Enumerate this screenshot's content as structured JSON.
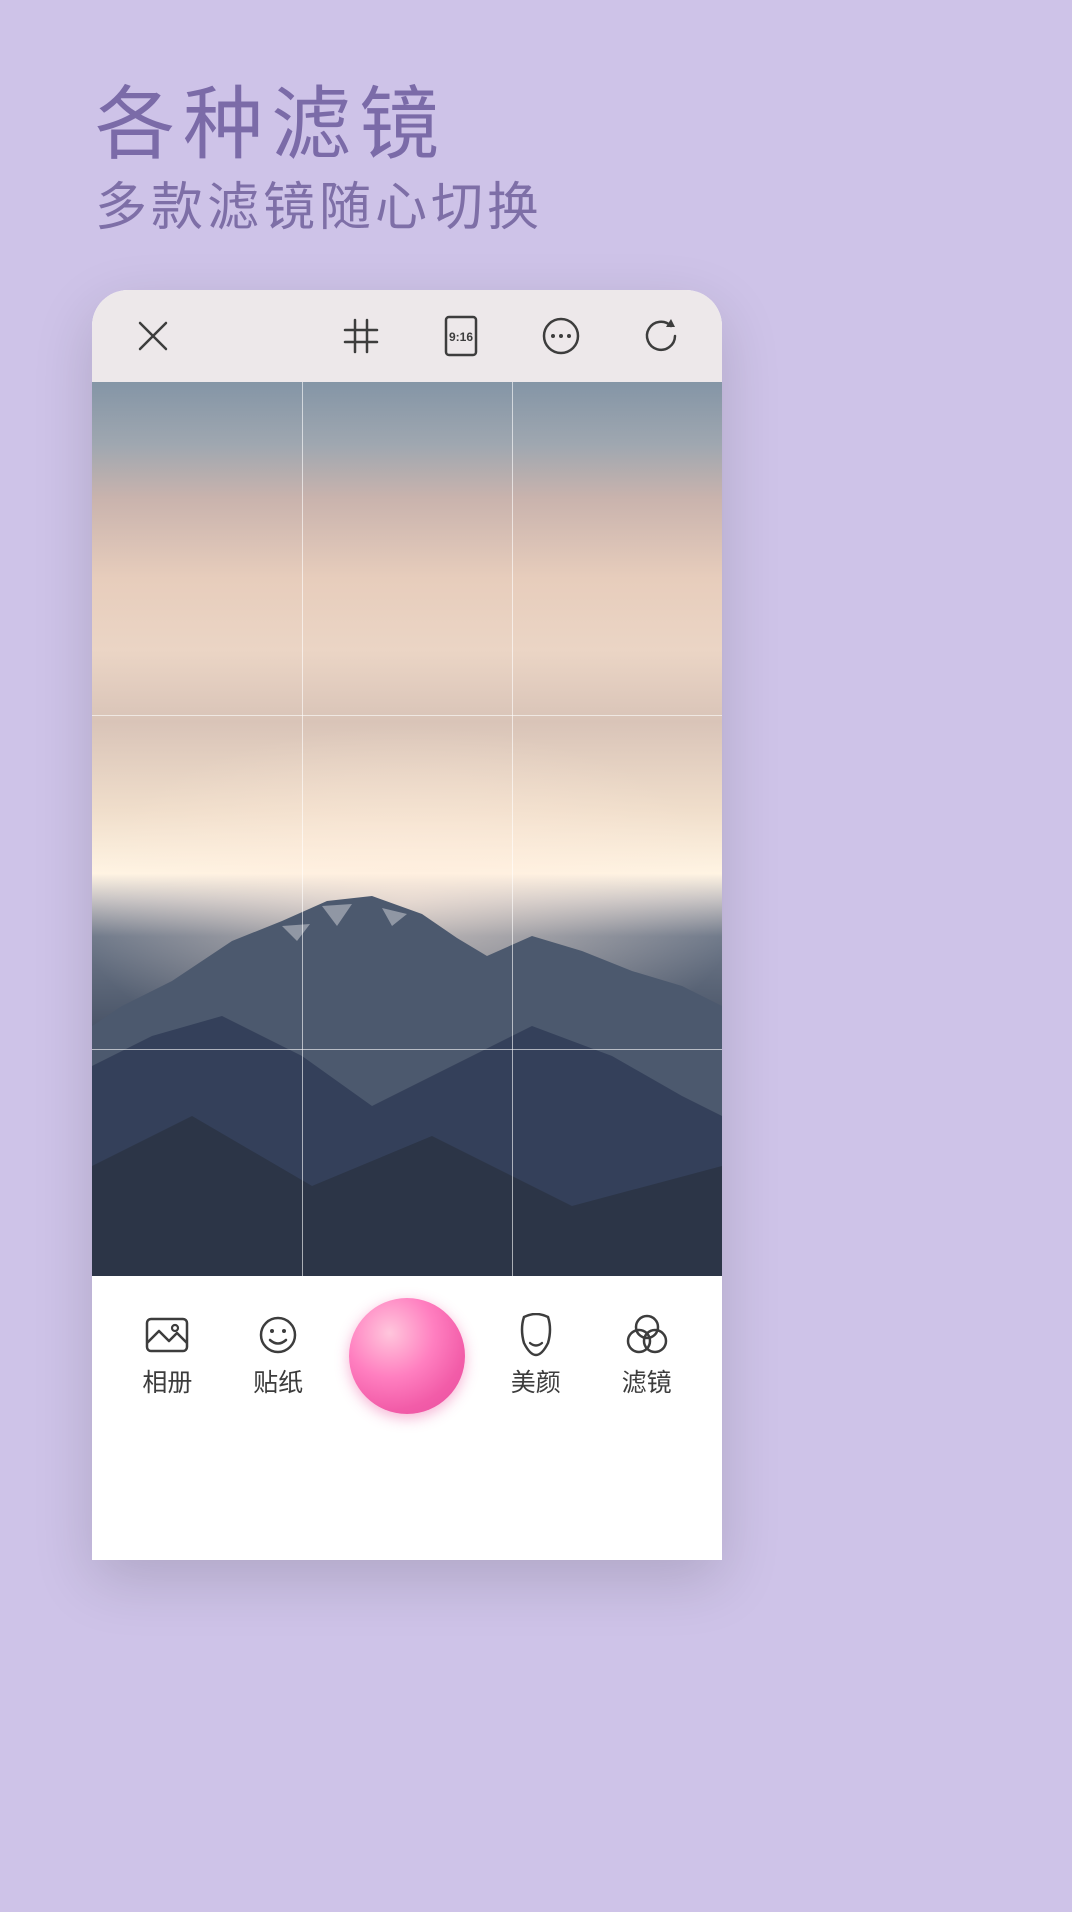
{
  "promo": {
    "title": "各种滤镜",
    "subtitle": "多款滤镜随心切换"
  },
  "topbar": {
    "close_icon": "close",
    "grid_icon": "grid",
    "aspect_icon": "aspect-ratio",
    "aspect_label": "9:16",
    "more_icon": "more",
    "flip_icon": "camera-flip"
  },
  "viewfinder": {
    "subject": "mountain-sunset-clouds",
    "grid_columns": 3,
    "grid_rows": 3
  },
  "bottom": {
    "gallery": {
      "label": "相册",
      "icon": "gallery"
    },
    "sticker": {
      "label": "贴纸",
      "icon": "smile"
    },
    "beauty": {
      "label": "美颜",
      "icon": "face"
    },
    "filter": {
      "label": "滤镜",
      "icon": "overlap-circles"
    }
  },
  "colors": {
    "bg": "#CEC3E8",
    "text_purple": "#7B6BA8",
    "topbar_bg": "#EDE8EA",
    "icon_stroke": "#3D3D3D",
    "shutter_pink_1": "#FFC6DC",
    "shutter_pink_2": "#E94FA1"
  }
}
